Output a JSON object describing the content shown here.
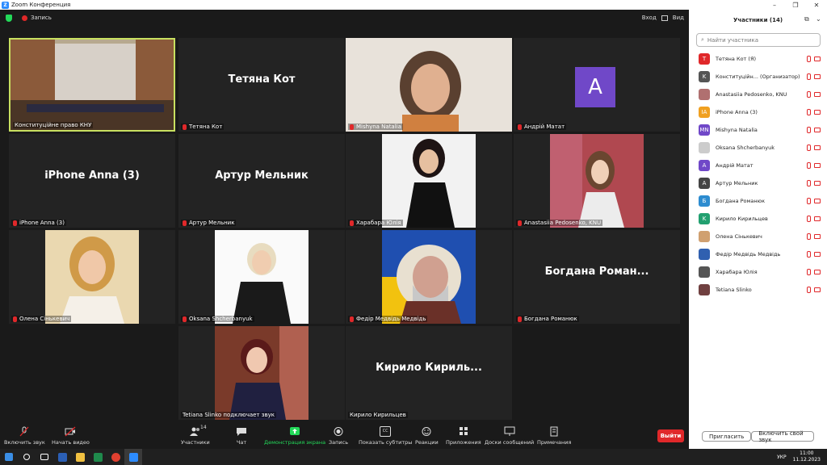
{
  "window": {
    "title": "Zoom Конференция"
  },
  "topbar": {
    "recording": "Запись",
    "view": "Вид",
    "enter": "Вход"
  },
  "tiles": [
    {
      "name": "Конституційне право КНУ",
      "kind": "room"
    },
    {
      "name": "Тетяна Кот",
      "big": "Тетяна Кот"
    },
    {
      "name": "Mishyna Natalia",
      "kind": "photo"
    },
    {
      "name": "Андрій Матат",
      "avatar": "A"
    },
    {
      "name": "iPhone Anna (3)",
      "big": "iPhone Anna (3)"
    },
    {
      "name": "Артур Мельник",
      "big": "Артур Мельник"
    },
    {
      "name": "Харабара Юлія",
      "kind": "photo"
    },
    {
      "name": "Anastasiia Pedosenko, KNU",
      "kind": "photo"
    },
    {
      "name": "Олена Сінькевич",
      "kind": "photo"
    },
    {
      "name": "Oksana Shcherbanyuk",
      "kind": "photo"
    },
    {
      "name": "Федір Медвідь Медвідь",
      "kind": "photo"
    },
    {
      "name": "Богдана Романюк",
      "big": "Богдана Роман..."
    },
    {
      "name": "Tetiana Slinko подключает звук",
      "kind": "photo"
    },
    {
      "name": "Кирило Кирильцев",
      "big": "Кирило Кириль..."
    }
  ],
  "toolbar": {
    "audio": "Включить звук",
    "video": "Начать видео",
    "participants": "Участники",
    "participants_count": "14",
    "chat": "Чат",
    "share": "Демонстрация экрана",
    "record": "Запись",
    "captions": "Показать субтитры",
    "captions_badge": "CC",
    "reactions": "Реакции",
    "apps": "Приложения",
    "whiteboards": "Доски сообщений",
    "notes": "Примечания",
    "leave": "Выйти"
  },
  "panel": {
    "title": "Участники (14)",
    "search_placeholder": "Найти участника",
    "participants": [
      {
        "name": "Тетяна Кот (Я)",
        "initials": "T",
        "color": "#e0282a"
      },
      {
        "name": "Конституційн... (Организатор)",
        "initials": "K",
        "color": "#555555"
      },
      {
        "name": "Anastasiia Pedosenko, KNU",
        "initials": "",
        "color": "#b07070"
      },
      {
        "name": "iPhone Anna (3)",
        "initials": "IA",
        "color": "#f0a020"
      },
      {
        "name": "Mishyna Natalia",
        "initials": "MN",
        "color": "#7048c8"
      },
      {
        "name": "Oksana Shcherbanyuk",
        "initials": "",
        "color": "#cccccc"
      },
      {
        "name": "Андрій Матат",
        "initials": "A",
        "color": "#7048c8"
      },
      {
        "name": "Артур Мельник",
        "initials": "A",
        "color": "#444444"
      },
      {
        "name": "Богдана Романюк",
        "initials": "Б",
        "color": "#2d8cd0"
      },
      {
        "name": "Кирило Кирильцев",
        "initials": "K",
        "color": "#22a070"
      },
      {
        "name": "Олена Сінькевич",
        "initials": "",
        "color": "#d0a070"
      },
      {
        "name": "Федір Медвідь Медвідь",
        "initials": "",
        "color": "#3060b0"
      },
      {
        "name": "Харабара Юлія",
        "initials": "",
        "color": "#555555"
      },
      {
        "name": "Tetiana Slinko",
        "initials": "",
        "color": "#704040"
      }
    ],
    "invite": "Пригласить",
    "unmute_self": "Включить свой звук"
  },
  "taskbar": {
    "lang": "УКР",
    "time": "11:00",
    "date": "11.12.2023"
  }
}
